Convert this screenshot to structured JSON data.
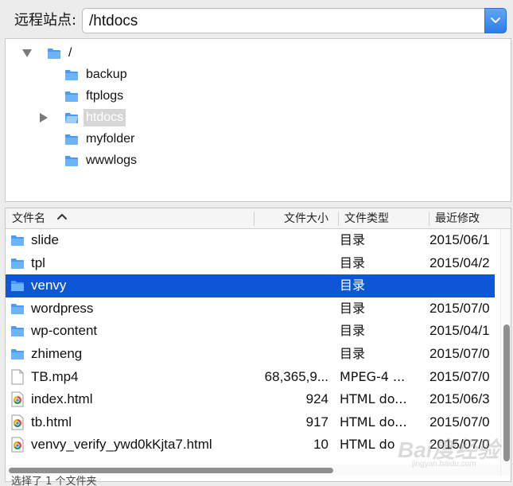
{
  "path_bar": {
    "label": "远程站点:",
    "value": "/htdocs"
  },
  "tree": {
    "root": "/",
    "items": [
      {
        "label": "backup",
        "selected": false,
        "expandable": false
      },
      {
        "label": "ftplogs",
        "selected": false,
        "expandable": false
      },
      {
        "label": "htdocs",
        "selected": true,
        "expandable": true
      },
      {
        "label": "myfolder",
        "selected": false,
        "expandable": false
      },
      {
        "label": "wwwlogs",
        "selected": false,
        "expandable": false
      }
    ]
  },
  "file_list": {
    "columns": {
      "name": "文件名",
      "size": "文件大小",
      "type": "文件类型",
      "modified": "最近修改"
    },
    "rows": [
      {
        "name": "slide",
        "size": "",
        "type": "目录",
        "modified": "2015/06/1",
        "icon": "folder-icon",
        "selected": false
      },
      {
        "name": "tpl",
        "size": "",
        "type": "目录",
        "modified": "2015/04/2",
        "icon": "folder-icon",
        "selected": false
      },
      {
        "name": "venvy",
        "size": "",
        "type": "目录",
        "modified": "",
        "icon": "folder-icon",
        "selected": true
      },
      {
        "name": "wordpress",
        "size": "",
        "type": "目录",
        "modified": "2015/07/0",
        "icon": "folder-icon",
        "selected": false
      },
      {
        "name": "wp-content",
        "size": "",
        "type": "目录",
        "modified": "2015/04/1",
        "icon": "folder-icon",
        "selected": false
      },
      {
        "name": "zhimeng",
        "size": "",
        "type": "目录",
        "modified": "2015/07/0",
        "icon": "folder-icon",
        "selected": false
      },
      {
        "name": "TB.mp4",
        "size": "68,365,9...",
        "type": "MPEG-4 ...",
        "modified": "2015/07/0",
        "icon": "blank-file-icon",
        "selected": false
      },
      {
        "name": "index.html",
        "size": "924",
        "type": "HTML do...",
        "modified": "2015/06/3",
        "icon": "chrome-html-file-icon",
        "selected": false
      },
      {
        "name": "tb.html",
        "size": "917",
        "type": "HTML do...",
        "modified": "2015/07/0",
        "icon": "chrome-html-file-icon",
        "selected": false
      },
      {
        "name": "venvy_verify_ywd0kKjta7.html",
        "size": "10",
        "type": "HTML do",
        "modified": "2015/07/0",
        "icon": "chrome-html-file-icon",
        "selected": false
      }
    ]
  },
  "status": {
    "text": "选择了 1 个文件夹"
  },
  "watermark": {
    "main": "Bai度经验",
    "sub": "jingyan.baidu.com"
  },
  "colors": {
    "selection": "#0d57d6",
    "dropdown": "#2d7de8",
    "folder": "#4a9cf2"
  }
}
